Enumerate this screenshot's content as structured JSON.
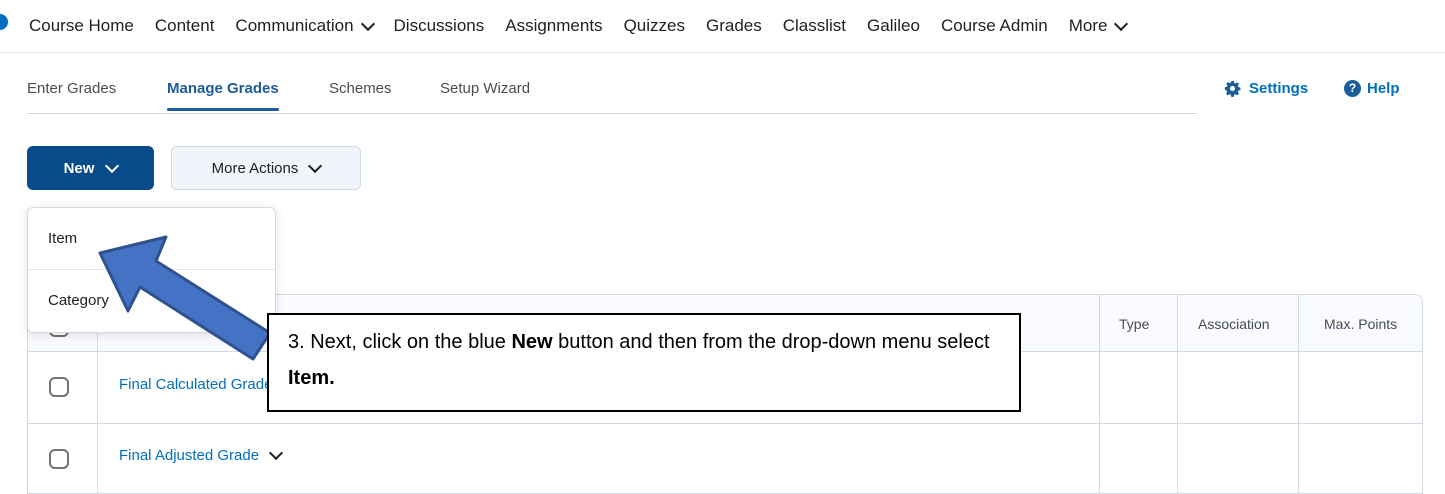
{
  "topnav": {
    "items": [
      {
        "label": "Course Home"
      },
      {
        "label": "Content"
      },
      {
        "label": "Communication"
      },
      {
        "label": "Discussions"
      },
      {
        "label": "Assignments"
      },
      {
        "label": "Quizzes"
      },
      {
        "label": "Grades"
      },
      {
        "label": "Classlist"
      },
      {
        "label": "Galileo"
      },
      {
        "label": "Course Admin"
      },
      {
        "label": "More"
      }
    ]
  },
  "subtabs": {
    "enter_grades": "Enter Grades",
    "manage_grades": "Manage Grades",
    "schemes": "Schemes",
    "setup_wizard": "Setup Wizard"
  },
  "links": {
    "settings": "Settings",
    "help": "Help"
  },
  "toolbar": {
    "new_label": "New",
    "more_actions_label": "More Actions"
  },
  "dropdown": {
    "items": [
      "Item",
      "Category"
    ]
  },
  "table": {
    "columns": {
      "type": "Type",
      "association": "Association",
      "max_points": "Max. Points"
    },
    "rows": [
      {
        "name": "Final Calculated Grade"
      },
      {
        "name": "Final Adjusted Grade"
      }
    ]
  },
  "annotation": {
    "prefix": "3. Next, click on the blue ",
    "bold1": "New",
    "middle": " button and then from the drop-down menu select ",
    "bold2": "Item."
  },
  "colors": {
    "brand_blue": "#084b8a",
    "link_blue": "#006fbf",
    "arrow_fill": "#4472c4",
    "arrow_stroke": "#2f528f"
  }
}
